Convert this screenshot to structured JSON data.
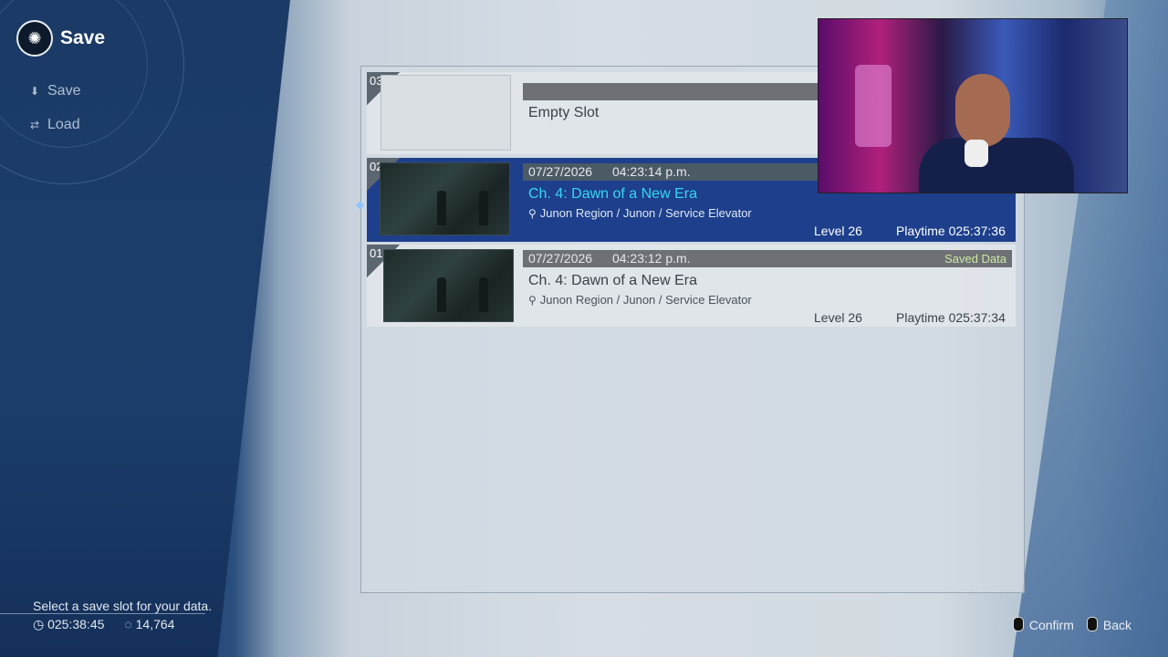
{
  "header": {
    "title": "Save"
  },
  "menu": [
    {
      "label": "Save",
      "icon": "download-icon"
    },
    {
      "label": "Load",
      "icon": "swap-icon"
    }
  ],
  "slots": [
    {
      "num": "03",
      "empty": true,
      "title": "Empty Slot"
    },
    {
      "num": "02",
      "date": "07/27/2026",
      "time": "04:23:14 p.m.",
      "title": "Ch. 4: Dawn of a New Era",
      "location": "Junon Region / Junon / Service Elevator",
      "level": "Level 26",
      "playtime": "Playtime 025:37:36",
      "selected": true
    },
    {
      "num": "01",
      "date": "07/27/2026",
      "time": "04:23:12 p.m.",
      "badge": "Saved Data",
      "title": "Ch. 4: Dawn of a New Era",
      "location": "Junon Region / Junon / Service Elevator",
      "level": "Level 26",
      "playtime": "Playtime 025:37:34"
    }
  ],
  "footer": {
    "help": "Select a save slot for your data.",
    "playtime": "025:38:45",
    "gil": "14,764",
    "confirm": "Confirm",
    "back": "Back"
  },
  "colors": {
    "selected": "#1d3f8c",
    "title_selected": "#38d6f0",
    "saved_badge": "#cfe8a0"
  }
}
